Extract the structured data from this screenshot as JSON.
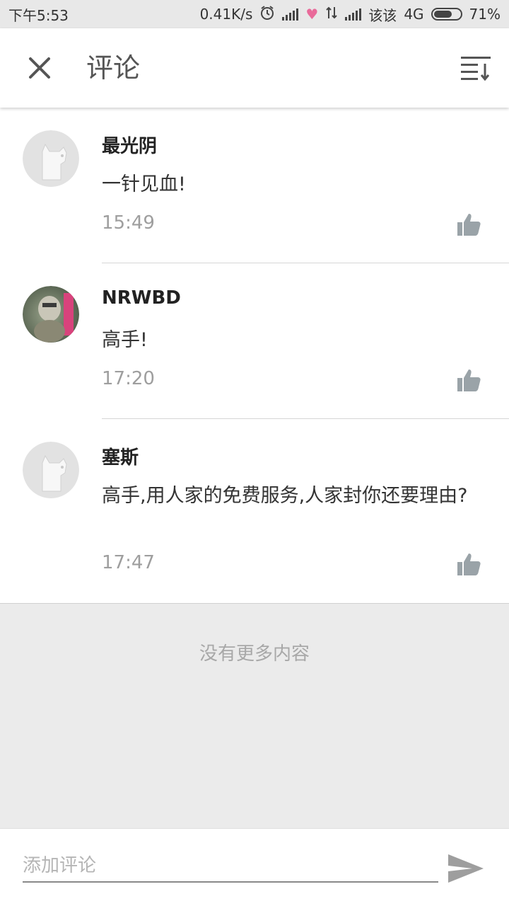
{
  "status_bar": {
    "time": "下午5:53",
    "net_speed": "0.41K/s",
    "carrier": "该该",
    "network": "4G",
    "battery_pct": "71%",
    "battery_level": 0.71
  },
  "header": {
    "title": "评论"
  },
  "comments": [
    {
      "username": "最光阴",
      "text": "一针见血!",
      "time": "15:49",
      "avatar": "default-dog-avatar"
    },
    {
      "username": "NRWBD",
      "text": "高手!",
      "time": "17:20",
      "avatar": "photo-avatar"
    },
    {
      "username": "塞斯",
      "text": "高手,用人家的免费服务,人家封你还要理由?",
      "time": "17:47",
      "avatar": "default-dog-avatar"
    }
  ],
  "footer": {
    "no_more": "没有更多内容"
  },
  "input": {
    "placeholder": "添加评论"
  },
  "colors": {
    "status_bar_bg": "#e8e8e8",
    "icon_gray": "#9aa3a8",
    "list_end_bg": "#ebebeb"
  }
}
